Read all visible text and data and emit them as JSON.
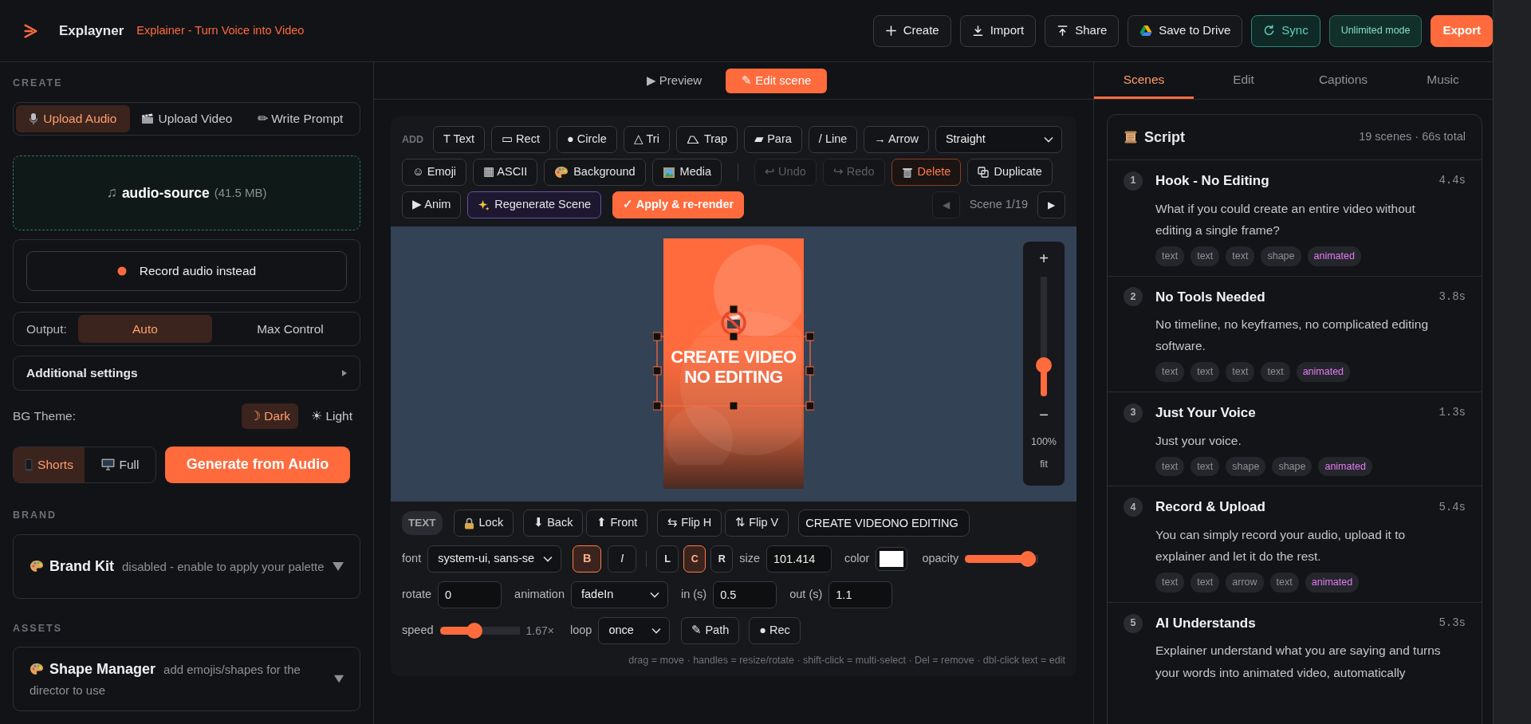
{
  "app": {
    "name": "Explayner",
    "subtitle": "Explainer - Turn Voice into Video"
  },
  "header_buttons": [
    {
      "label": "Create",
      "kind": "default"
    },
    {
      "label": "Import",
      "kind": "default"
    },
    {
      "label": "Share",
      "kind": "default"
    },
    {
      "label": "Save to Drive",
      "kind": "default"
    },
    {
      "label": "Sync",
      "kind": "teal"
    },
    {
      "label": "Unlimited mode",
      "kind": "badge"
    },
    {
      "label": "Export",
      "kind": "primary"
    }
  ],
  "left": {
    "section": "CREATE",
    "source_tabs": [
      {
        "label": "Upload Audio",
        "selected": true
      },
      {
        "label": "Upload Video",
        "selected": false
      },
      {
        "label": "✏ Write Prompt",
        "selected": false
      }
    ],
    "file": {
      "icon": "♫",
      "name": "audio-source",
      "size": "(41.5 MB)"
    },
    "record_button": "Record audio instead",
    "output": {
      "label": "Output:",
      "options": [
        {
          "label": "Auto",
          "selected": true
        },
        {
          "label": "Max Control",
          "selected": false
        }
      ]
    },
    "additional_settings": "Additional settings",
    "bg_theme": {
      "label": "BG Theme:",
      "options": [
        {
          "label": "☽ Dark",
          "selected": true
        },
        {
          "label": "☀ Light",
          "selected": false
        }
      ]
    },
    "format": [
      {
        "label": "Shorts",
        "selected": true
      },
      {
        "label": "Full",
        "selected": false
      }
    ],
    "generate_button": "Generate from Audio",
    "brand_section": "BRAND",
    "brand_kit": {
      "title": "Brand Kit",
      "note": "disabled - enable to apply your palette"
    },
    "assets_section": "ASSETS",
    "shape_manager": {
      "title": "Shape Manager",
      "note": "add emojis/shapes for the director to use"
    }
  },
  "center": {
    "mode_tabs": [
      {
        "label": "▶ Preview",
        "selected": false
      },
      {
        "label": "✎ Edit scene",
        "selected": true
      }
    ],
    "add_label": "ADD",
    "shape_buttons": [
      "T Text",
      "▭ Rect",
      "● Circle",
      "△ Tri",
      "Trap",
      "▰ Para",
      "/ Line",
      "→ Arrow"
    ],
    "line_style": "Straight",
    "row2": [
      {
        "label": "☺ Emoji",
        "kind": "tool"
      },
      {
        "label": "▦ ASCII",
        "kind": "tool"
      },
      {
        "label": "Background",
        "kind": "tool"
      },
      {
        "label": "Media",
        "kind": "tool"
      },
      {
        "label": "↩ Undo",
        "kind": "disabled"
      },
      {
        "label": "↪ Redo",
        "kind": "disabled"
      },
      {
        "label": "Delete",
        "kind": "danger"
      },
      {
        "label": "Duplicate",
        "kind": "tool"
      }
    ],
    "row3": [
      {
        "label": "▶ Anim",
        "kind": "tool"
      },
      {
        "label": "Regenerate Scene",
        "kind": "regen"
      },
      {
        "label": "✓ Apply & re-render",
        "kind": "primary"
      }
    ],
    "scene_nav": {
      "prev": "◀",
      "prev_disabled": true,
      "label": "Scene 1/19",
      "next": "▶",
      "next_disabled": false
    },
    "canvas": {
      "text_lines": [
        "CREATE VIDEO",
        "NO EDITING"
      ],
      "zoom": {
        "plus": "+",
        "minus": "−",
        "level": 0.22,
        "percent": "100%",
        "fit": "fit"
      }
    },
    "element_type": "TEXT",
    "element_buttons": [
      "Lock",
      "⬇ Back",
      "⬆ Front",
      "⇆ Flip H",
      "⇅ Flip V"
    ],
    "text_value": "CREATE VIDEONO EDITING",
    "font": {
      "label": "font",
      "value": "system-ui, sans-se"
    },
    "style_toggles": [
      {
        "label": "B",
        "selected": true
      },
      {
        "label": "I",
        "selected": false
      }
    ],
    "align_toggles": [
      {
        "label": "L",
        "selected": false
      },
      {
        "label": "C",
        "selected": true
      },
      {
        "label": "R",
        "selected": false
      }
    ],
    "size": {
      "label": "size",
      "value": "101.414"
    },
    "swatch": {
      "label": "color",
      "color": "#ffffff"
    },
    "opacity": {
      "label": "opacity",
      "level": 0.96
    },
    "rotate": {
      "label": "rotate",
      "value": "0"
    },
    "animation": {
      "label": "animation",
      "value": "fadeIn"
    },
    "in": {
      "label": "in (s)",
      "value": "0.5"
    },
    "out": {
      "label": "out (s)",
      "value": "1.1"
    },
    "speed": {
      "label": "speed",
      "level": 0.42,
      "reading": "1.67×"
    },
    "loop": {
      "label": "loop",
      "value": "once"
    },
    "path_button": "✎ Path",
    "rec_button": "● Rec",
    "hint": "drag = move · handles = resize/rotate · shift-click = multi-select · Del = remove · dbl-click text = edit"
  },
  "right": {
    "tabs": [
      {
        "label": "Scenes",
        "selected": true
      },
      {
        "label": "Edit",
        "selected": false
      },
      {
        "label": "Captions",
        "selected": false
      },
      {
        "label": "Music",
        "selected": false
      }
    ],
    "script": {
      "title": "Script",
      "summary": "19 scenes · 66s total",
      "scenes": [
        {
          "number": "1",
          "title": "Hook - No Editing",
          "duration": "4.4s",
          "text": "What if you could create an entire video without editing a single frame?",
          "tags": [
            {
              "label": "text",
              "kind": "element"
            },
            {
              "label": "text",
              "kind": "element"
            },
            {
              "label": "text",
              "kind": "element"
            },
            {
              "label": "shape",
              "kind": "element"
            },
            {
              "label": "animated",
              "kind": "animated"
            }
          ]
        },
        {
          "number": "2",
          "title": "No Tools Needed",
          "duration": "3.8s",
          "text": "No timeline, no keyframes, no complicated editing software.",
          "tags": [
            {
              "label": "text",
              "kind": "element"
            },
            {
              "label": "text",
              "kind": "element"
            },
            {
              "label": "text",
              "kind": "element"
            },
            {
              "label": "text",
              "kind": "element"
            },
            {
              "label": "animated",
              "kind": "animated"
            }
          ]
        },
        {
          "number": "3",
          "title": "Just Your Voice",
          "duration": "1.3s",
          "text": "Just your voice.",
          "tags": [
            {
              "label": "text",
              "kind": "element"
            },
            {
              "label": "text",
              "kind": "element"
            },
            {
              "label": "shape",
              "kind": "element"
            },
            {
              "label": "shape",
              "kind": "element"
            },
            {
              "label": "animated",
              "kind": "animated"
            }
          ]
        },
        {
          "number": "4",
          "title": "Record & Upload",
          "duration": "5.4s",
          "text": "You can simply record your audio, upload it to explainer and let it do the rest.",
          "tags": [
            {
              "label": "text",
              "kind": "element"
            },
            {
              "label": "text",
              "kind": "element"
            },
            {
              "label": "arrow",
              "kind": "element"
            },
            {
              "label": "text",
              "kind": "element"
            },
            {
              "label": "animated",
              "kind": "animated"
            }
          ]
        },
        {
          "number": "5",
          "title": "AI Understands",
          "duration": "5.3s",
          "text": "Explainer understand what you are saying and turns your words into animated video, automatically"
        }
      ]
    }
  }
}
